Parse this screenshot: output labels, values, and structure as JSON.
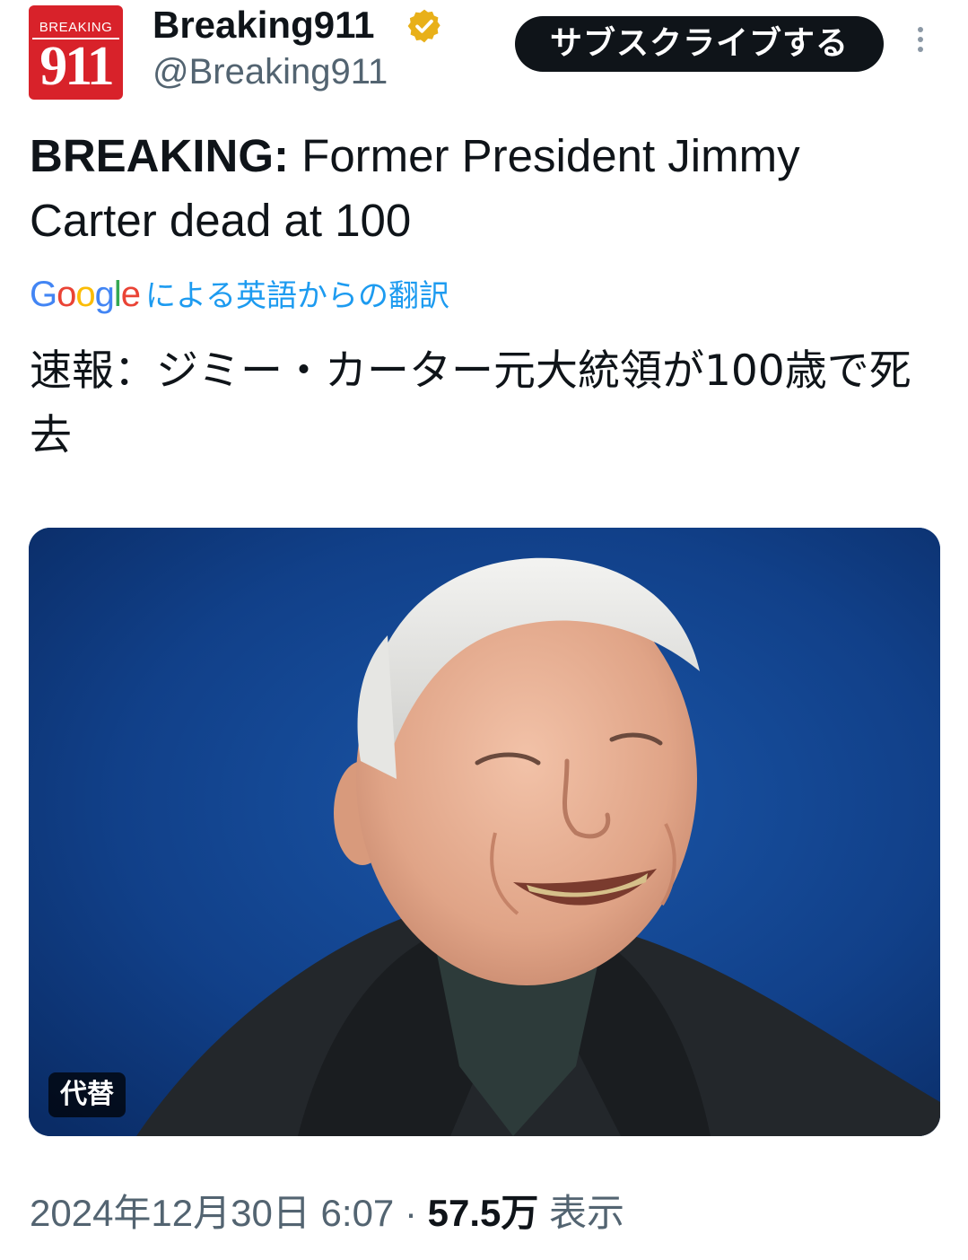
{
  "account": {
    "logo_top": "BREAKING",
    "logo_num": "911",
    "display_name": "Breaking911",
    "handle": "@Breaking911",
    "verified": true,
    "verified_color": "#e8b019"
  },
  "header": {
    "subscribe_label": "サブスクライブする",
    "more_icon": "more-vertical-icon"
  },
  "tweet": {
    "text_lead": "BREAKING:",
    "text_body": " Former President Jimmy Carter dead at 100",
    "translate_logo": "Google",
    "translate_label": "による英語からの翻訳",
    "translated_text": "速報：ジミー・カーター元大統領が100歳で死去",
    "media_alt_label": "代替",
    "timestamp": "2024年12月30日 6:07",
    "separator": "·",
    "views_count": "57.5万",
    "views_label": "表示"
  },
  "colors": {
    "link": "#1d9bf0",
    "secondary_text": "#536471",
    "primary_text": "#0f1419",
    "brand_red": "#d8222a",
    "media_background": "#0f3d82"
  }
}
